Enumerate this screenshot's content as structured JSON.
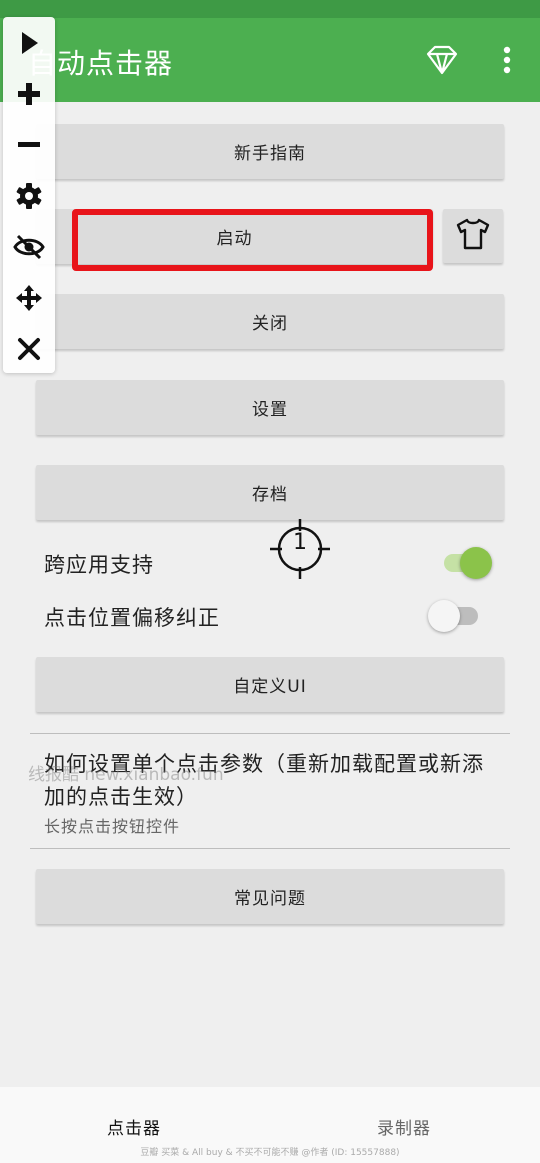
{
  "app": {
    "title": "自动点击器"
  },
  "buttons": {
    "guide": "新手指南",
    "start": "启动",
    "close": "关闭",
    "settings": "设置",
    "archive": "存档",
    "custom_ui": "自定义UI",
    "faq": "常见问题"
  },
  "toggles": [
    {
      "label": "跨应用支持",
      "on": true
    },
    {
      "label": "点击位置偏移纠正",
      "on": false
    }
  ],
  "info": {
    "title": "如何设置单个点击参数（重新加载配置或新添加的点击生效）",
    "subtitle": "长按点击按钮控件"
  },
  "target": {
    "number": "1"
  },
  "watermark": "线报酷 new.xianbao.fun",
  "bottom_nav": {
    "tabs": [
      "点击器",
      "录制器"
    ],
    "active_index": 0,
    "footer": "豆瓣 买菜 & All buy & 不买不可能不赚 @作者 (ID: 15557888)"
  },
  "colors": {
    "app_bar": "#4caf50",
    "status_bar": "#3e9a45",
    "highlight": "#e8141a",
    "toggle_on": "#8bc34a"
  },
  "icons": [
    "play-icon",
    "plus-icon",
    "minus-icon",
    "gear-icon",
    "eye-off-icon",
    "move-icon",
    "close-icon",
    "diamond-icon",
    "more-vert-icon",
    "shirt-icon",
    "crosshair-icon"
  ]
}
